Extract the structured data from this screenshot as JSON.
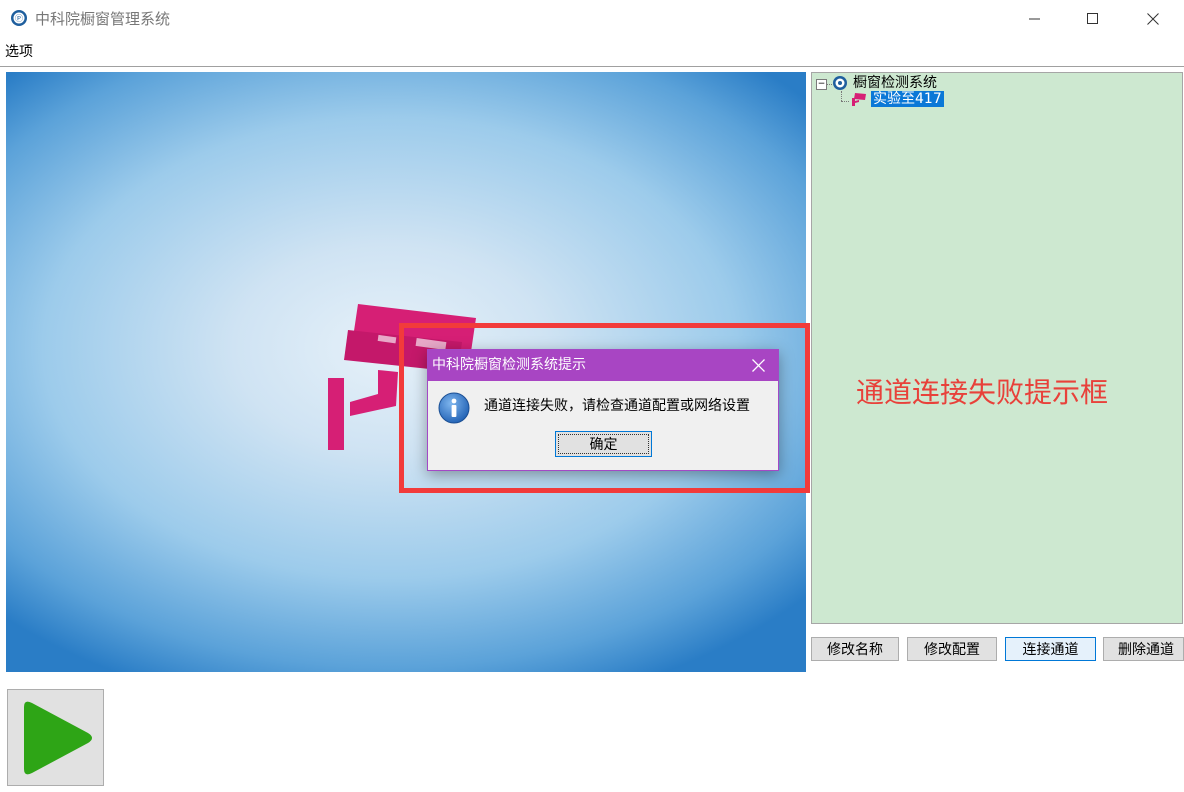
{
  "window": {
    "title": "中科院橱窗管理系统",
    "icon": "app-logo-icon",
    "controls": [
      "minimize-icon",
      "maximize-icon",
      "close-icon"
    ]
  },
  "menu": {
    "options_label": "选项"
  },
  "video": {
    "icon": "security-camera-icon",
    "accent_color": "#d61f75"
  },
  "tree": {
    "root_label": "橱窗检测系统",
    "root_icon": "app-logo-icon",
    "children": [
      {
        "label": "实验至417",
        "icon": "camera-icon",
        "selected": true
      }
    ]
  },
  "annotation": {
    "label": "通道连接失败提示框",
    "color": "#f23b3b"
  },
  "actions": {
    "rename_label": "修改名称",
    "config_label": "修改配置",
    "connect_label": "连接通道",
    "delete_label": "删除通道"
  },
  "play": {
    "icon": "play-icon",
    "color": "#2ea516"
  },
  "dialog": {
    "title": "中科院橱窗检测系统提示",
    "message": "通道连接失败，请检查通道配置或网络设置",
    "ok_label": "确定",
    "icon": "info-icon",
    "title_color": "#a845c3"
  }
}
